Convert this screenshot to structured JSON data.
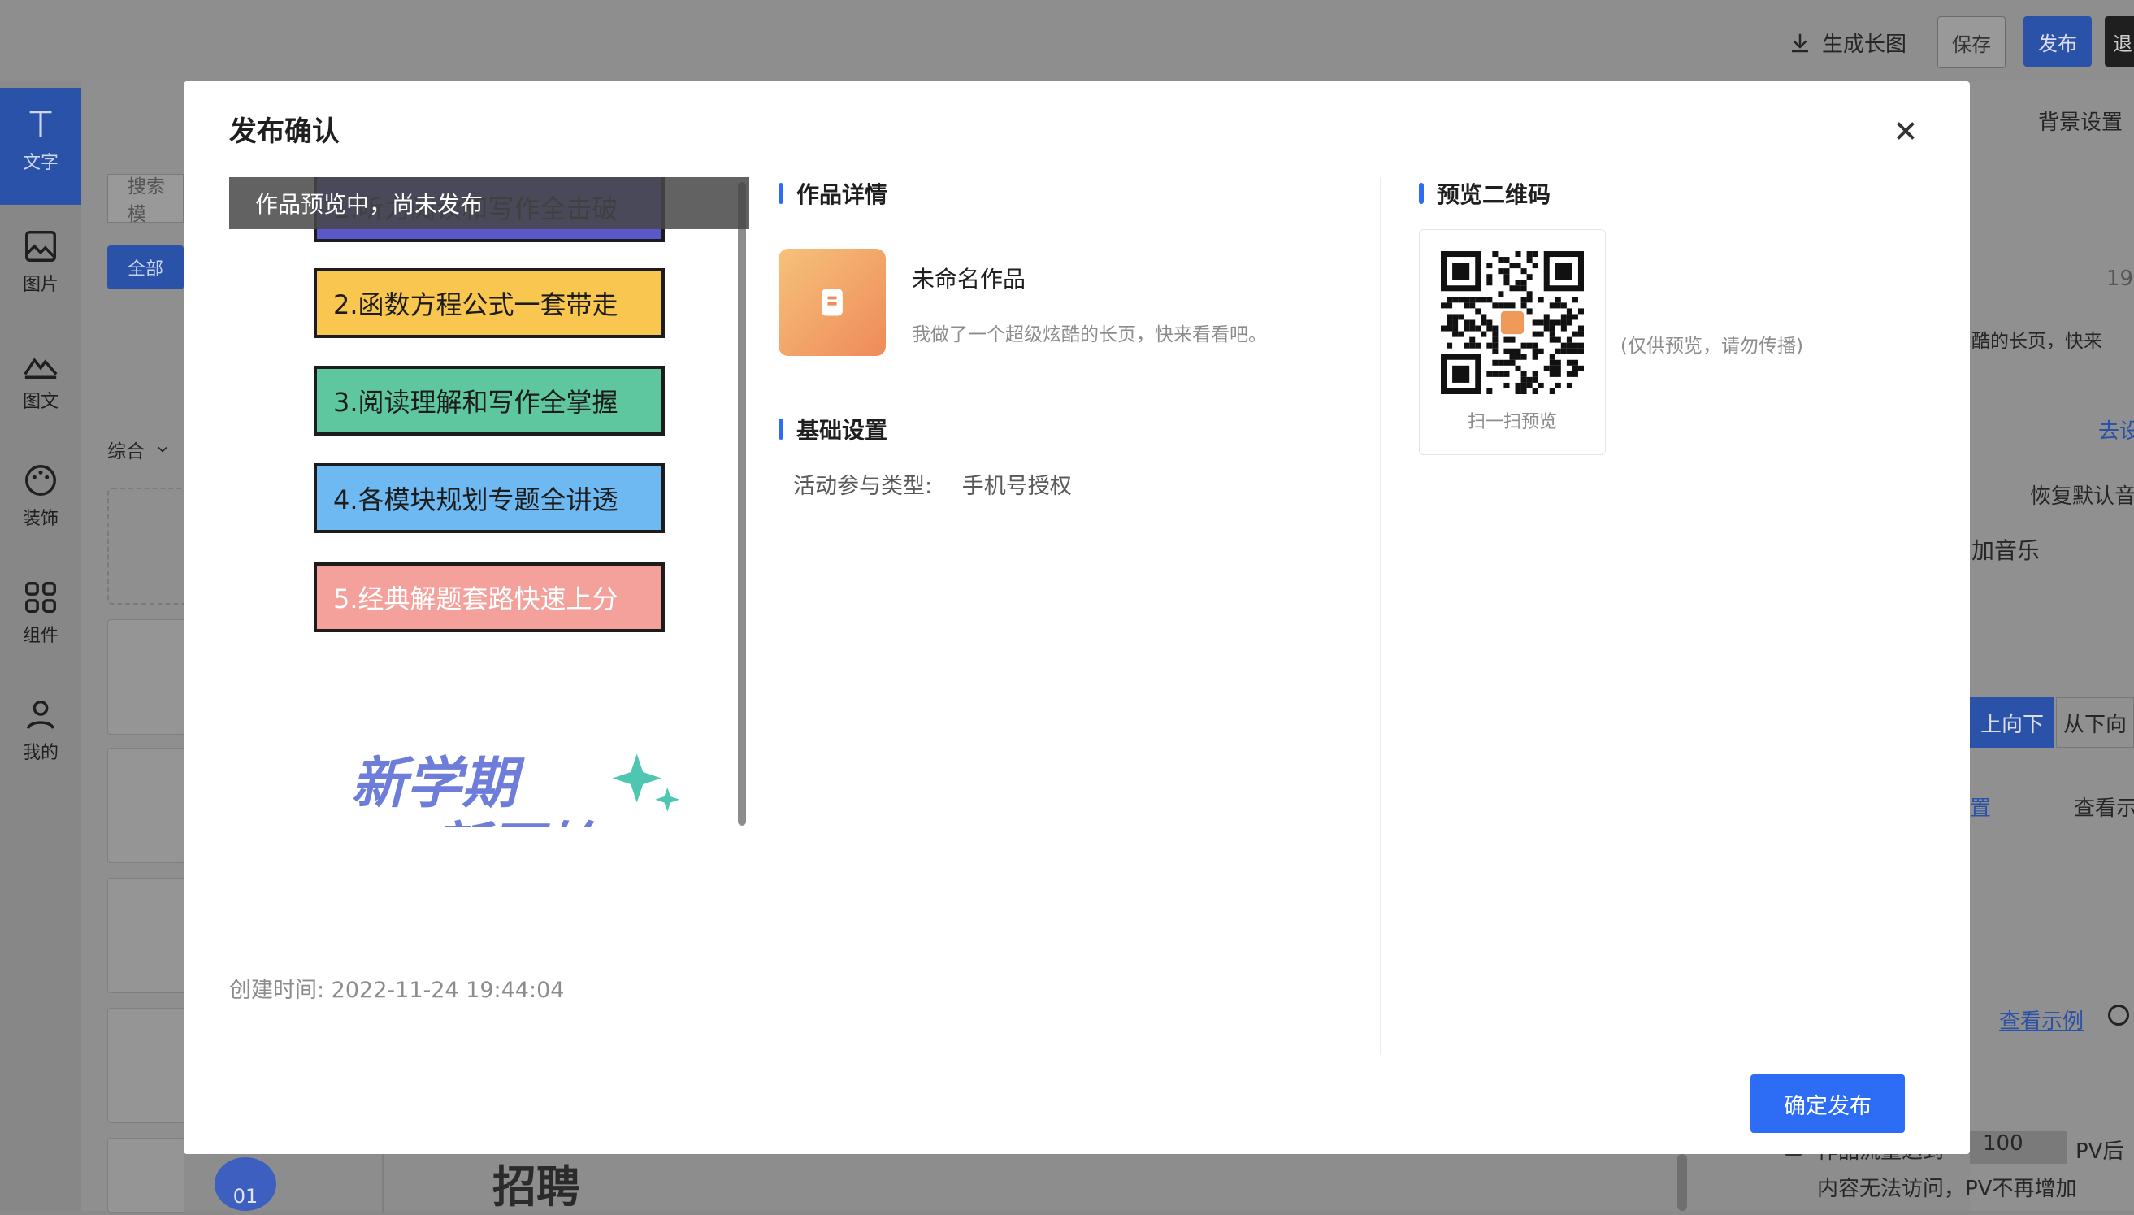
{
  "header": {
    "generate_long_image": "生成长图",
    "save": "保存",
    "publish": "发布",
    "exit": "退"
  },
  "sidebar": {
    "items": [
      {
        "label": "文字"
      },
      {
        "label": "图片"
      },
      {
        "label": "图文"
      },
      {
        "label": "装饰"
      },
      {
        "label": "组件"
      },
      {
        "label": "我的"
      }
    ]
  },
  "left_panel": {
    "search_placeholder": "搜索模",
    "filter_all": "全部",
    "sort_label": "综合",
    "recruit_text": "招聘",
    "badge_text": "01"
  },
  "right_panel": {
    "background_settings": "背景设置",
    "number": "19",
    "desc_snippet": "酷的长页，快来",
    "go_link": "去设",
    "restore_default": "恢复默认音",
    "add_music": "加音乐",
    "dir_top_down": "上向下",
    "dir_bottom_up": "从下向",
    "settings_link": "置",
    "view_example_1": "查看示",
    "view_example_2": "查看示例",
    "pv_value": "100",
    "pv_suffix": "PV后",
    "pv_prefix": "作品流量达到",
    "pv_note": "内容无法访问，PV不再增加"
  },
  "modal": {
    "title": "发布确认",
    "preview_banner": "作品预览中，尚未发布",
    "preview_cards": [
      {
        "text": "1.听力阅读和写作全击破",
        "color": "#5a58c8"
      },
      {
        "text": "2.函数方程公式一套带走",
        "color": "#f9c74f"
      },
      {
        "text": "3.阅读理解和写作全掌握",
        "color": "#5fc7a0"
      },
      {
        "text": "4.各模块规划专题全讲透",
        "color": "#6fb9f2"
      },
      {
        "text": "5.经典解题套路快速上分",
        "color": "#f4a09b"
      }
    ],
    "slogan_line1": "新学期",
    "slogan_line2": "新开始",
    "created_time": "创建时间: 2022-11-24 19:44:04",
    "work_detail_title": "作品详情",
    "work_name": "未命名作品",
    "work_desc": "我做了一个超级炫酷的长页，快来看看吧。",
    "basic_settings_title": "基础设置",
    "activity_type_label": "活动参与类型:",
    "activity_type_value": "手机号授权",
    "qr_title": "预览二维码",
    "qr_caption": "扫一扫预览",
    "qr_note": "(仅供预览，请勿传播)",
    "confirm_button": "确定发布"
  },
  "colors": {
    "accent": "#2d6cf5",
    "overlay": "#8a8a8a",
    "active_sidebar": "#2d6cf5"
  }
}
